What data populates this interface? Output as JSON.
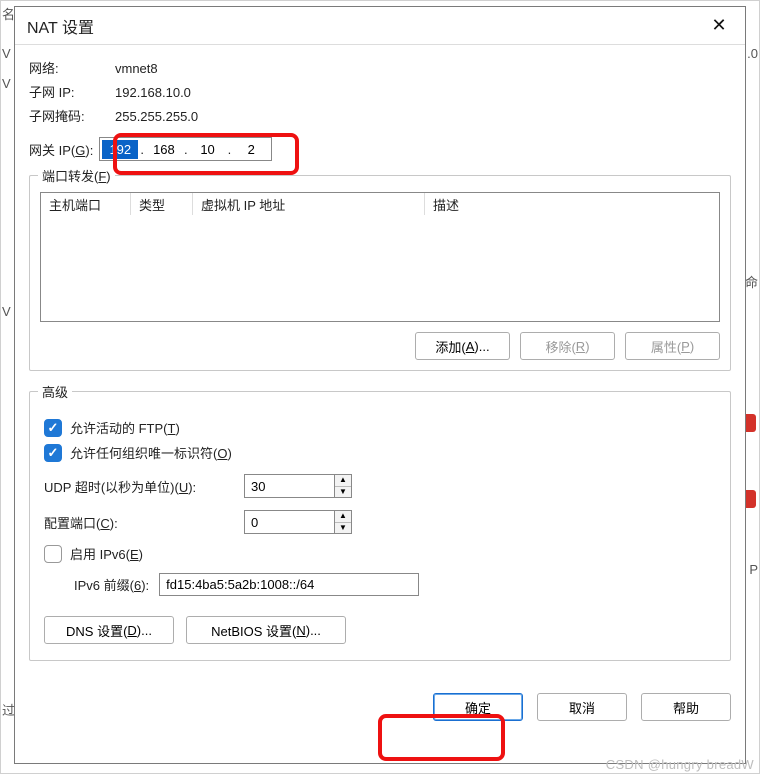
{
  "title": "NAT 设置",
  "bg": {
    "text1": "名",
    "text2": "V",
    "text3": "V",
    "text4": "V",
    "text5": "命",
    "text6": ".0",
    "text7": "P",
    "text8": "过"
  },
  "info": {
    "network_label": "网络:",
    "network_value": "vmnet8",
    "subnet_ip_label": "子网 IP:",
    "subnet_ip_value": "192.168.10.0",
    "subnet_mask_label": "子网掩码:",
    "subnet_mask_value": "255.255.255.0",
    "gateway_label_pre": "网关 IP(",
    "gateway_label_u": "G",
    "gateway_label_post": "):",
    "gateway_octets": [
      "192",
      "168",
      "10",
      "2"
    ]
  },
  "portfwd": {
    "legend_pre": "端口转发(",
    "legend_u": "F",
    "legend_post": ")",
    "headers": {
      "host_port": "主机端口",
      "type": "类型",
      "vm_ip": "虚拟机 IP 地址",
      "desc": "描述"
    },
    "add_pre": "添加(",
    "add_u": "A",
    "add_post": ")...",
    "remove_pre": "移除(",
    "remove_u": "R",
    "remove_post": ")",
    "prop_pre": "属性(",
    "prop_u": "P",
    "prop_post": ")"
  },
  "advanced": {
    "legend": "高级",
    "ftp_pre": "允许活动的 FTP(",
    "ftp_u": "T",
    "ftp_post": ")",
    "ftp_checked": true,
    "oui_pre": "允许任何组织唯一标识符(",
    "oui_u": "O",
    "oui_post": ")",
    "oui_checked": true,
    "udp_label_pre": "UDP 超时(以秒为单位)(",
    "udp_label_u": "U",
    "udp_label_post": "):",
    "udp_value": "30",
    "cfgport_label_pre": "配置端口(",
    "cfgport_label_u": "C",
    "cfgport_label_post": "):",
    "cfgport_value": "0",
    "ipv6_enable_pre": "启用 IPv6(",
    "ipv6_enable_u": "E",
    "ipv6_enable_post": ")",
    "ipv6_checked": false,
    "ipv6_prefix_label_pre": "IPv6 前缀(",
    "ipv6_prefix_label_u": "6",
    "ipv6_prefix_label_post": "):",
    "ipv6_prefix_value": "fd15:4ba5:5a2b:1008::/64",
    "dns_pre": "DNS 设置(",
    "dns_u": "D",
    "dns_post": ")...",
    "netbios_pre": "NetBIOS 设置(",
    "netbios_u": "N",
    "netbios_post": ")..."
  },
  "footer": {
    "ok": "确定",
    "cancel": "取消",
    "help": "帮助"
  },
  "watermark": "CSDN @hungry breadW"
}
